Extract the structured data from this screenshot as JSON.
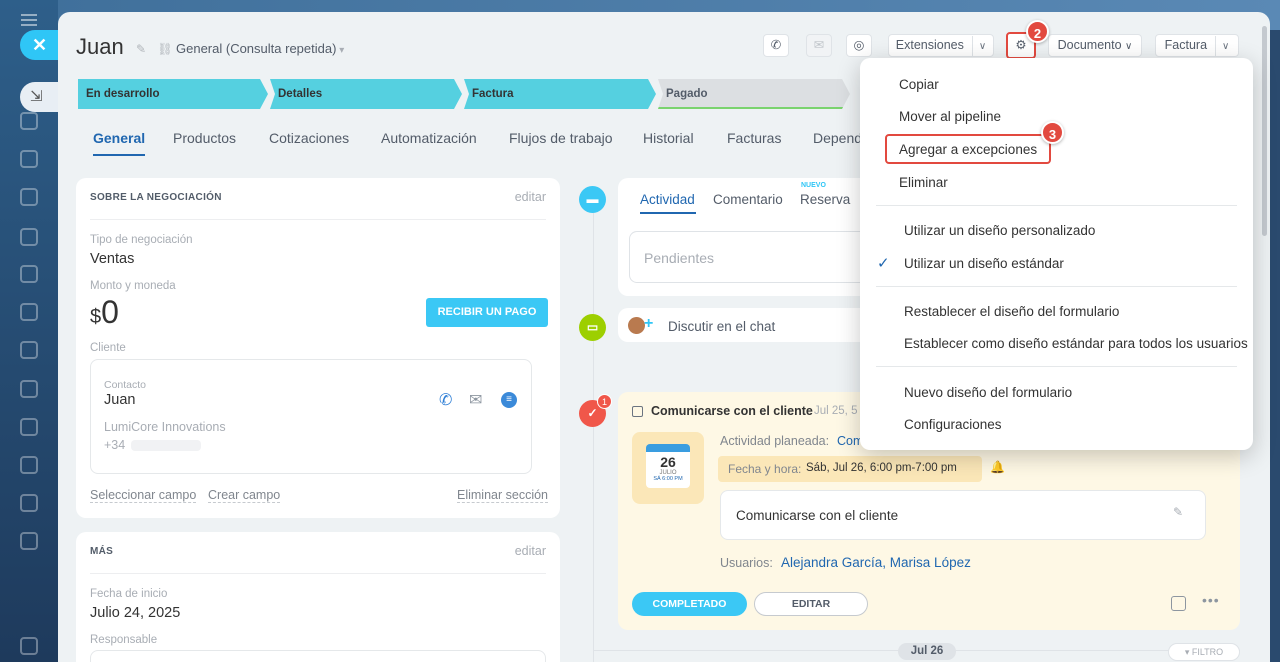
{
  "header": {
    "title": "Juan",
    "pipeline": "General (Consulta repetida)",
    "extensions_label": "Extensiones",
    "document_label": "Documento",
    "invoice_label": "Factura"
  },
  "stages": [
    {
      "label": "En desarrollo",
      "state": "active"
    },
    {
      "label": "Detalles",
      "state": "active"
    },
    {
      "label": "Factura",
      "state": "active"
    },
    {
      "label": "Pagado",
      "state": "inactive"
    }
  ],
  "tabs": [
    "General",
    "Productos",
    "Cotizaciones",
    "Automatización",
    "Flujos de trabajo",
    "Historial",
    "Facturas",
    "Depend"
  ],
  "deal_section": {
    "heading": "SOBRE LA NEGOCIACIÓN",
    "edit": "editar",
    "type_label": "Tipo de negociación",
    "type_value": "Ventas",
    "amount_label": "Monto y moneda",
    "currency": "$",
    "amount": "0",
    "pay_button": "RECIBIR UN PAGO",
    "client_label": "Cliente",
    "contact_label": "Contacto",
    "contact_name": "Juan",
    "company": "LumiCore Innovations",
    "phone": "+34",
    "select_field": "Seleccionar campo",
    "create_field": "Crear campo",
    "delete_section": "Eliminar sección"
  },
  "more_section": {
    "heading": "MÁS",
    "edit": "editar",
    "start_label": "Fecha de inicio",
    "start_value": "Julio 24, 2025",
    "responsible_label": "Responsable"
  },
  "activity": {
    "tab_activity": "Actividad",
    "tab_comment": "Comentario",
    "tab_booking": "Reserva",
    "new_tag": "NUEVO",
    "pending_placeholder": "Pendientes",
    "chat_text": "Discutir en el chat",
    "task_title": "Comunicarse con el cliente",
    "task_date": "Jul 25, 5",
    "task_count": "1",
    "planned_label": "Actividad planeada:",
    "planned_value": "Com",
    "datetime_label": "Fecha y hora:",
    "datetime_value": "Sáb, Jul 26, 6:00 pm-7:00 pm",
    "cal_day": "26",
    "cal_month": "JULIO",
    "cal_time": "SÁ 6:00 PM",
    "note": "Comunicarse con el cliente",
    "users_label": "Usuarios:",
    "users_value": "Alejandra García, Marisa López",
    "complete_btn": "COMPLETADO",
    "edit_btn": "EDITAR",
    "date_pill": "Jul 26",
    "filter": "FILTRO"
  },
  "menu": {
    "items": [
      "Copiar",
      "Mover al pipeline",
      "Agregar a excepciones",
      "Eliminar",
      "Utilizar un diseño personalizado",
      "Utilizar un diseño estándar",
      "Restablecer el diseño del formulario",
      "Establecer como diseño estándar para todos los usuarios",
      "Nuevo diseño del formulario",
      "Configuraciones"
    ]
  },
  "annotations": {
    "gear_step": "2",
    "menu_step": "3"
  },
  "colors": {
    "accent": "#2067b0",
    "stage": "#55d0e0",
    "highlight": "#e2493f",
    "pay": "#3bc8f5"
  }
}
